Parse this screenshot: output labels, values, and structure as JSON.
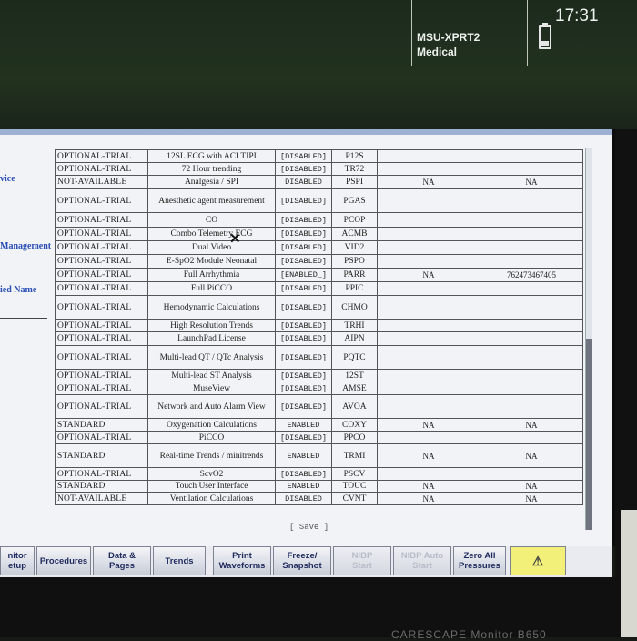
{
  "header": {
    "device_line1": "MSU-XPRT2",
    "device_line2": "Medical",
    "time": "17:31"
  },
  "sidebar": {
    "items": [
      "vice",
      "Management",
      "ied Name"
    ]
  },
  "table": {
    "rows": [
      {
        "mode": "OPTIONAL-TRIAL",
        "name": "12SL ECG with ACI TIPI",
        "status": "[DISABLED]",
        "code": "P12S",
        "v1": "",
        "v2": ""
      },
      {
        "mode": "OPTIONAL-TRIAL",
        "name": "72 Hour trending",
        "status": "[DISABLED]",
        "code": "TR72",
        "v1": "",
        "v2": ""
      },
      {
        "mode": "NOT-AVAILABLE",
        "name": "Analgesia / SPI",
        "status": "DISABLED",
        "code": "PSPI",
        "v1": "NA",
        "v2": "NA"
      },
      {
        "mode": "OPTIONAL-TRIAL",
        "name": "Anesthetic agent measurement",
        "status": "[DISABLED]",
        "code": "PGAS",
        "v1": "",
        "v2": ""
      },
      {
        "mode": "OPTIONAL-TRIAL",
        "name": "CO",
        "status": "[DISABLED]",
        "code": "PCOP",
        "v1": "",
        "v2": ""
      },
      {
        "mode": "OPTIONAL-TRIAL",
        "name": "Combo Telemetry ECG",
        "status": "[DISABLED]",
        "code": "ACMB",
        "v1": "",
        "v2": ""
      },
      {
        "mode": "OPTIONAL-TRIAL",
        "name": "Dual Video",
        "status": "[DISABLED]",
        "code": "VID2",
        "v1": "",
        "v2": ""
      },
      {
        "mode": "OPTIONAL-TRIAL",
        "name": "E-SpO2 Module Neonatal",
        "status": "[DISABLED]",
        "code": "PSPO",
        "v1": "",
        "v2": ""
      },
      {
        "mode": "OPTIONAL-TRIAL",
        "name": "Full Arrhythmia",
        "status": "[ENABLED_]",
        "code": "PARR",
        "v1": "NA",
        "v2": "762473467405"
      },
      {
        "mode": "OPTIONAL-TRIAL",
        "name": "Full PiCCO",
        "status": "[DISABLED]",
        "code": "PPIC",
        "v1": "",
        "v2": ""
      },
      {
        "mode": "OPTIONAL-TRIAL",
        "name": "Hemodynamic Calculations",
        "status": "[DISABLED]",
        "code": "CHMO",
        "v1": "",
        "v2": ""
      },
      {
        "mode": "OPTIONAL-TRIAL",
        "name": "High Resolution Trends",
        "status": "[DISABLED]",
        "code": "TRHI",
        "v1": "",
        "v2": ""
      },
      {
        "mode": "OPTIONAL-TRIAL",
        "name": "LaunchPad License",
        "status": "[DISABLED]",
        "code": "AIPN",
        "v1": "",
        "v2": ""
      },
      {
        "mode": "OPTIONAL-TRIAL",
        "name": "Multi-lead QT / QTc Analysis",
        "status": "[DISABLED]",
        "code": "PQTC",
        "v1": "",
        "v2": ""
      },
      {
        "mode": "OPTIONAL-TRIAL",
        "name": "Multi-lead ST Analysis",
        "status": "[DISABLED]",
        "code": "12ST",
        "v1": "",
        "v2": ""
      },
      {
        "mode": "OPTIONAL-TRIAL",
        "name": "MuseView",
        "status": "[DISABLED]",
        "code": "AMSE",
        "v1": "",
        "v2": ""
      },
      {
        "mode": "OPTIONAL-TRIAL",
        "name": "Network and Auto Alarm View",
        "status": "[DISABLED]",
        "code": "AVOA",
        "v1": "",
        "v2": ""
      },
      {
        "mode": "STANDARD",
        "name": "Oxygenation Calculations",
        "status": "ENABLED",
        "code": "COXY",
        "v1": "NA",
        "v2": "NA"
      },
      {
        "mode": "OPTIONAL-TRIAL",
        "name": "PiCCO",
        "status": "[DISABLED]",
        "code": "PPCO",
        "v1": "",
        "v2": ""
      },
      {
        "mode": "STANDARD",
        "name": "Real-time Trends / minitrends",
        "status": "ENABLED",
        "code": "TRMI",
        "v1": "NA",
        "v2": "NA"
      },
      {
        "mode": "OPTIONAL-TRIAL",
        "name": "ScvO2",
        "status": "[DISABLED]",
        "code": "PSCV",
        "v1": "",
        "v2": ""
      },
      {
        "mode": "STANDARD",
        "name": "Touch User Interface",
        "status": "ENABLED",
        "code": "TOUC",
        "v1": "NA",
        "v2": "NA"
      },
      {
        "mode": "NOT-AVAILABLE",
        "name": "Ventilation Calculations",
        "status": "DISABLED",
        "code": "CVNT",
        "v1": "NA",
        "v2": "NA"
      }
    ]
  },
  "save_label": "[ Save ]",
  "softkeys": [
    {
      "label": "nitor\netup",
      "state": "enabled"
    },
    {
      "label": "Procedures",
      "state": "enabled"
    },
    {
      "label": "Data &\nPages",
      "state": "enabled"
    },
    {
      "label": "Trends",
      "state": "enabled"
    },
    {
      "label": "Print\nWaveforms",
      "state": "enabled"
    },
    {
      "label": "Freeze/\nSnapshot",
      "state": "enabled"
    },
    {
      "label": "NIBP\nStart",
      "state": "disabled"
    },
    {
      "label": "NIBP Auto\nStart",
      "state": "disabled"
    },
    {
      "label": "Zero All\nPressures",
      "state": "enabled"
    },
    {
      "label": "⚠",
      "state": "alarm"
    }
  ],
  "brand": "CARESCAPE Monitor B650"
}
